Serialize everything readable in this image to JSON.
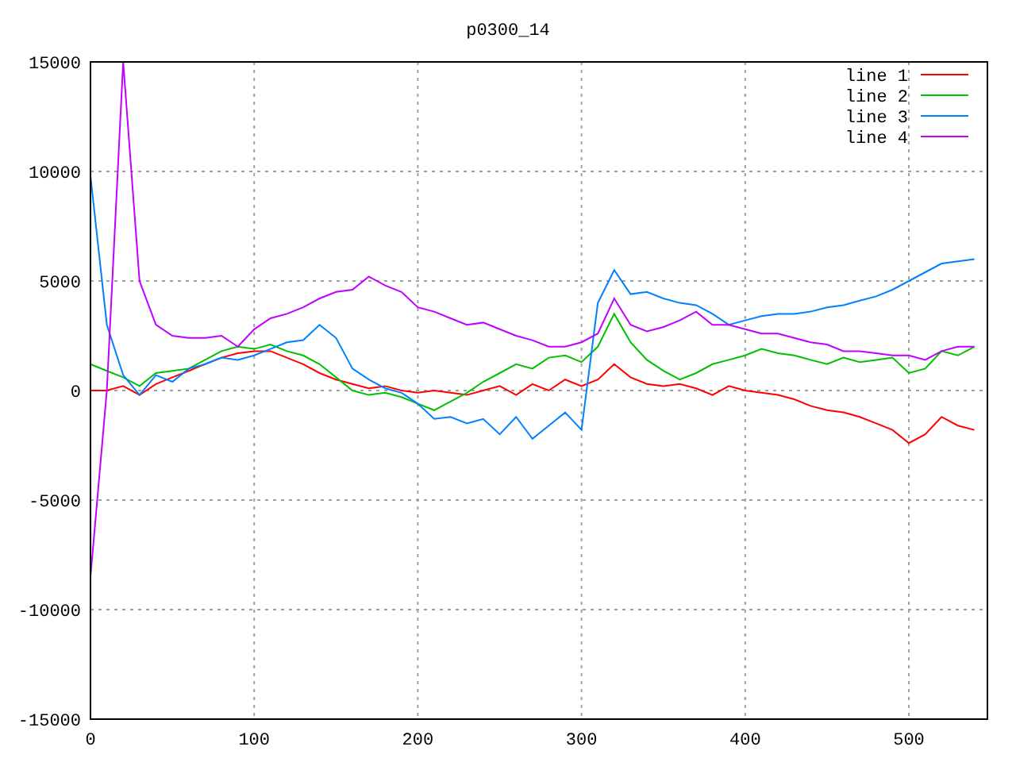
{
  "chart": {
    "chart_data": {
      "type": "line",
      "title": "p0300_14",
      "x": [
        0,
        10,
        20,
        30,
        40,
        50,
        60,
        70,
        80,
        90,
        100,
        110,
        120,
        130,
        140,
        150,
        160,
        170,
        180,
        190,
        200,
        210,
        220,
        230,
        240,
        250,
        260,
        270,
        280,
        290,
        300,
        310,
        320,
        330,
        340,
        350,
        360,
        370,
        380,
        390,
        400,
        410,
        420,
        430,
        440,
        450,
        460,
        470,
        480,
        490,
        500,
        510,
        520,
        530,
        540
      ],
      "xlim": [
        0,
        548
      ],
      "ylim": [
        -15000,
        15000
      ],
      "xticks": [
        0,
        100,
        200,
        300,
        400,
        500
      ],
      "yticks": [
        -15000,
        -10000,
        -5000,
        0,
        5000,
        10000,
        15000
      ],
      "grid": true,
      "legend": true,
      "series": [
        {
          "name": "line 1",
          "color": "#ff0000",
          "values": [
            0,
            0,
            200,
            -200,
            300,
            600,
            900,
            1200,
            1500,
            1700,
            1800,
            1800,
            1500,
            1200,
            800,
            500,
            300,
            100,
            200,
            0,
            -100,
            0,
            -100,
            -200,
            0,
            200,
            -200,
            300,
            0,
            500,
            200,
            500,
            1200,
            600,
            300,
            200,
            300,
            100,
            -200,
            200,
            0,
            -100,
            -200,
            -400,
            -700,
            -900,
            -1000,
            -1200,
            -1500,
            -1800,
            -2400,
            -2000,
            -1200,
            -1600,
            -1800
          ]
        },
        {
          "name": "line 2",
          "color": "#00c000",
          "values": [
            1200,
            900,
            600,
            200,
            800,
            900,
            1000,
            1400,
            1800,
            2000,
            1900,
            2100,
            1800,
            1600,
            1200,
            600,
            0,
            -200,
            -100,
            -300,
            -600,
            -900,
            -500,
            -100,
            400,
            800,
            1200,
            1000,
            1500,
            1600,
            1300,
            2000,
            3500,
            2200,
            1400,
            900,
            500,
            800,
            1200,
            1400,
            1600,
            1900,
            1700,
            1600,
            1400,
            1200,
            1500,
            1300,
            1400,
            1500,
            800,
            1000,
            1800,
            1600,
            2000
          ]
        },
        {
          "name": "line 3",
          "color": "#0080ff",
          "values": [
            9800,
            3000,
            700,
            -200,
            700,
            400,
            1000,
            1200,
            1500,
            1400,
            1600,
            1900,
            2200,
            2300,
            3000,
            2400,
            1000,
            500,
            100,
            -100,
            -600,
            -1300,
            -1200,
            -1500,
            -1300,
            -2000,
            -1200,
            -2200,
            -1600,
            -1000,
            -1800,
            4000,
            5500,
            4400,
            4500,
            4200,
            4000,
            3900,
            3500,
            3000,
            3200,
            3400,
            3500,
            3500,
            3600,
            3800,
            3900,
            4100,
            4300,
            4600,
            5000,
            5400,
            5800,
            5900,
            6000
          ]
        },
        {
          "name": "line 4",
          "color": "#c000ff",
          "values": [
            -8500,
            0,
            15000,
            5000,
            3000,
            2500,
            2400,
            2400,
            2500,
            2000,
            2800,
            3300,
            3500,
            3800,
            4200,
            4500,
            4600,
            5200,
            4800,
            4500,
            3800,
            3600,
            3300,
            3000,
            3100,
            2800,
            2500,
            2300,
            2000,
            2000,
            2200,
            2600,
            4200,
            3000,
            2700,
            2900,
            3200,
            3600,
            3000,
            3000,
            2800,
            2600,
            2600,
            2400,
            2200,
            2100,
            1800,
            1800,
            1700,
            1600,
            1600,
            1400,
            1800,
            2000,
            2000
          ]
        }
      ]
    }
  }
}
